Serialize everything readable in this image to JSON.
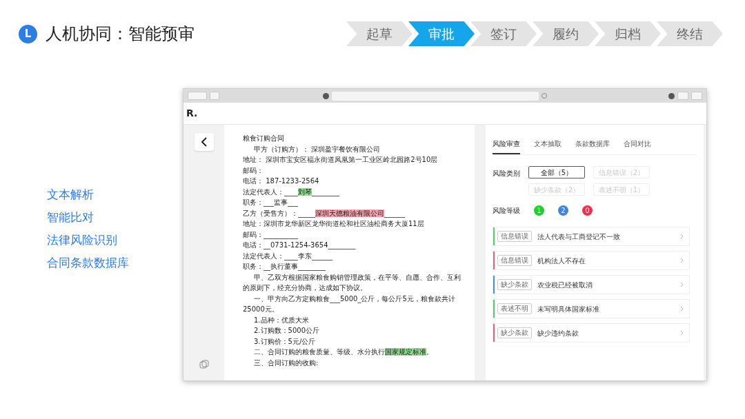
{
  "header": {
    "badge": "L",
    "title": "人机协同：智能预审"
  },
  "steps": [
    {
      "label": "起草",
      "selected": false
    },
    {
      "label": "审批",
      "selected": true
    },
    {
      "label": "签订",
      "selected": false
    },
    {
      "label": "履约",
      "selected": false
    },
    {
      "label": "归档",
      "selected": false
    },
    {
      "label": "终结",
      "selected": false
    }
  ],
  "features": [
    "文本解析",
    "智能比对",
    "法律风险识别",
    "合同条款数据库"
  ],
  "app": {
    "logo": "R.",
    "document": {
      "lines": [
        {
          "indent": false,
          "segments": [
            {
              "text": "粮食订购合同"
            }
          ]
        },
        {
          "indent": true,
          "segments": [
            {
              "text": "甲方（订购方）：  深圳盈宇餐饮有限公司"
            }
          ]
        },
        {
          "indent": false,
          "segments": [
            {
              "text": "地址：  深圳市宝安区福永街道凤凰第一工业区岭北园路2号10层"
            }
          ]
        },
        {
          "indent": false,
          "segments": [
            {
              "text": "邮码："
            }
          ]
        },
        {
          "indent": false,
          "segments": [
            {
              "text": "电话：  187-1233-2564"
            }
          ]
        },
        {
          "indent": false,
          "segments": [
            {
              "text": "法定代表人：____"
            },
            {
              "text": "刘琴",
              "color": "#8fe08f"
            },
            {
              "text": "________"
            }
          ]
        },
        {
          "indent": false,
          "segments": [
            {
              "text": "职务：___监事___"
            }
          ]
        },
        {
          "indent": false,
          "segments": [
            {
              "text": "乙方（受售方）：_____"
            },
            {
              "text": "深圳天德粮油有限公司",
              "color": "#f4a3ad"
            },
            {
              "text": "______"
            }
          ]
        },
        {
          "indent": false,
          "segments": [
            {
              "text": "地址：深圳市龙华新区龙华街道松和社区油松商务大厦11层"
            }
          ]
        },
        {
          "indent": false,
          "segments": [
            {
              "text": "邮码：__________"
            }
          ]
        },
        {
          "indent": false,
          "segments": [
            {
              "text": "电话：__0731-1254-3654________"
            }
          ]
        },
        {
          "indent": false,
          "segments": [
            {
              "text": "法定代表人：____李东______"
            }
          ]
        },
        {
          "indent": false,
          "segments": [
            {
              "text": "职务：__执行董事________"
            }
          ]
        },
        {
          "indent": true,
          "segments": [
            {
              "text": "甲、乙双方根据国家粮食购销管理政策，在平等、自愿、合作、互利的原则下，经充分协商，达成如下协议。"
            }
          ]
        },
        {
          "indent": true,
          "segments": [
            {
              "text": "一、甲方向乙方定购粮食___5000_公斤，每公斤5元，粮食款共计25000元。"
            }
          ]
        },
        {
          "indent": true,
          "segments": [
            {
              "text": "1.品种：优质大米"
            }
          ]
        },
        {
          "indent": true,
          "segments": [
            {
              "text": "2.订购数：5000公斤"
            }
          ]
        },
        {
          "indent": true,
          "segments": [
            {
              "text": "3.订购价：5元/公斤"
            }
          ]
        },
        {
          "indent": true,
          "segments": [
            {
              "text": "二、合同订购的粮食质量、等级、水分执行"
            },
            {
              "text": "国家规定标准",
              "color": "#8fe08f"
            },
            {
              "text": "。"
            }
          ]
        },
        {
          "indent": true,
          "segments": [
            {
              "text": "三、合同订购的收购:"
            }
          ]
        }
      ]
    },
    "panel": {
      "tabs": [
        {
          "label": "风险审查",
          "selected": true
        },
        {
          "label": "文本抽取",
          "selected": false
        },
        {
          "label": "条款数据库",
          "selected": false
        },
        {
          "label": "合同对比",
          "selected": false
        }
      ],
      "category_label": "风险类别",
      "categories": [
        {
          "label": "全部（5）",
          "selected": true
        },
        {
          "label": "信息错误（2）",
          "selected": false
        },
        {
          "label": "缺少条款（2）",
          "selected": false
        },
        {
          "label": "表述不明（1）",
          "selected": false
        }
      ],
      "level_label": "风险等级",
      "levels": [
        {
          "label": "1",
          "color": "#22cc33"
        },
        {
          "label": "2",
          "color": "#3a86e0"
        },
        {
          "label": "0",
          "color": "#e8324f"
        }
      ],
      "risks": [
        {
          "tag": "信息错误",
          "text": "法人代表与工商登记不一致",
          "color": "#5cc96a"
        },
        {
          "tag": "信息错误",
          "text": "机构法人不存在",
          "color": "#e06677"
        },
        {
          "tag": "缺少条款",
          "text": "农业税已经被取消",
          "color": "#4a8fd8"
        },
        {
          "tag": "表述不明",
          "text": "未写明具体国家标准",
          "color": "#5cc96a"
        },
        {
          "tag": "缺少条款",
          "text": "缺少违约条款",
          "color": "#e06677"
        }
      ]
    }
  }
}
